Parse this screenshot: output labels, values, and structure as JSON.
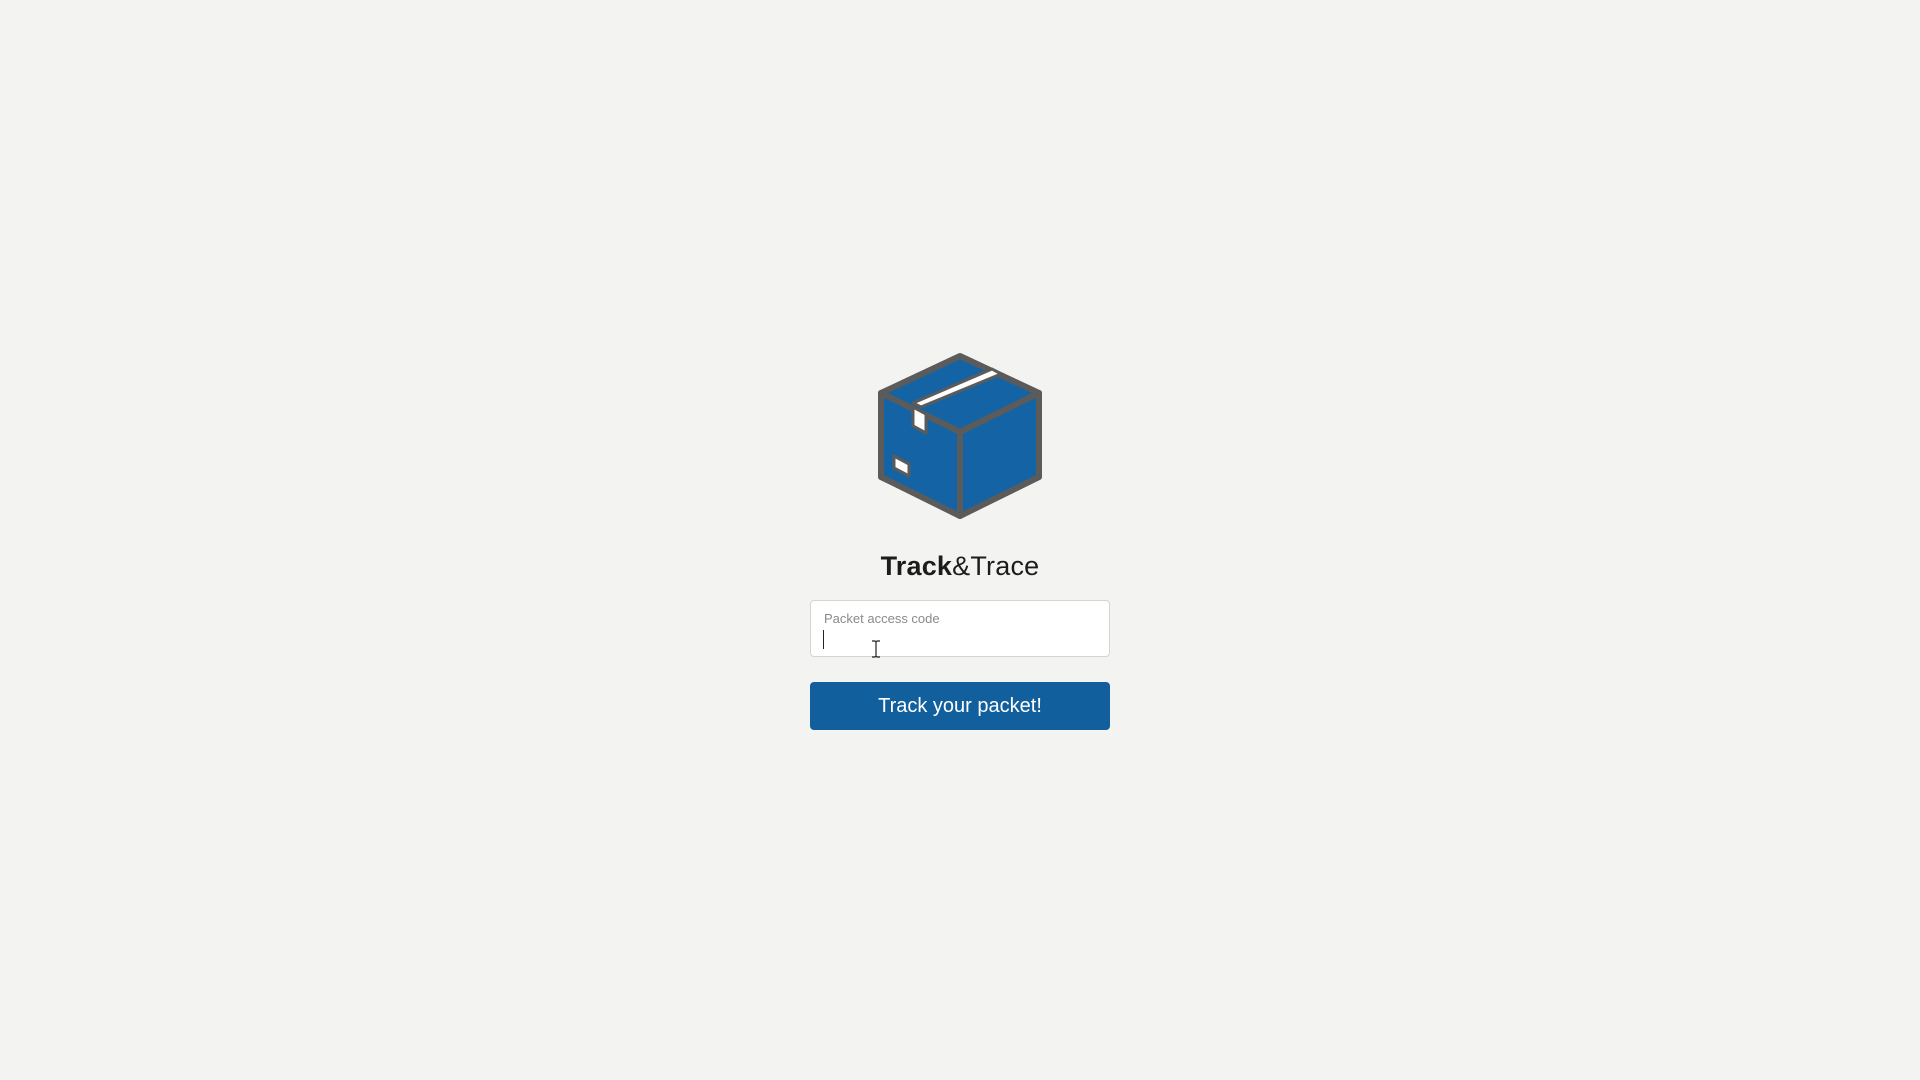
{
  "brand": {
    "name_bold": "Track",
    "name_rest": "&Trace",
    "logo_icon": "package-box-icon"
  },
  "form": {
    "field_label": "Packet access code",
    "field_value": "",
    "submit_label": "Track your packet!"
  },
  "colors": {
    "background": "#f3f3f2",
    "accent": "#11609d",
    "box_fill": "#1464a5",
    "box_outline": "#5b5b5b"
  }
}
